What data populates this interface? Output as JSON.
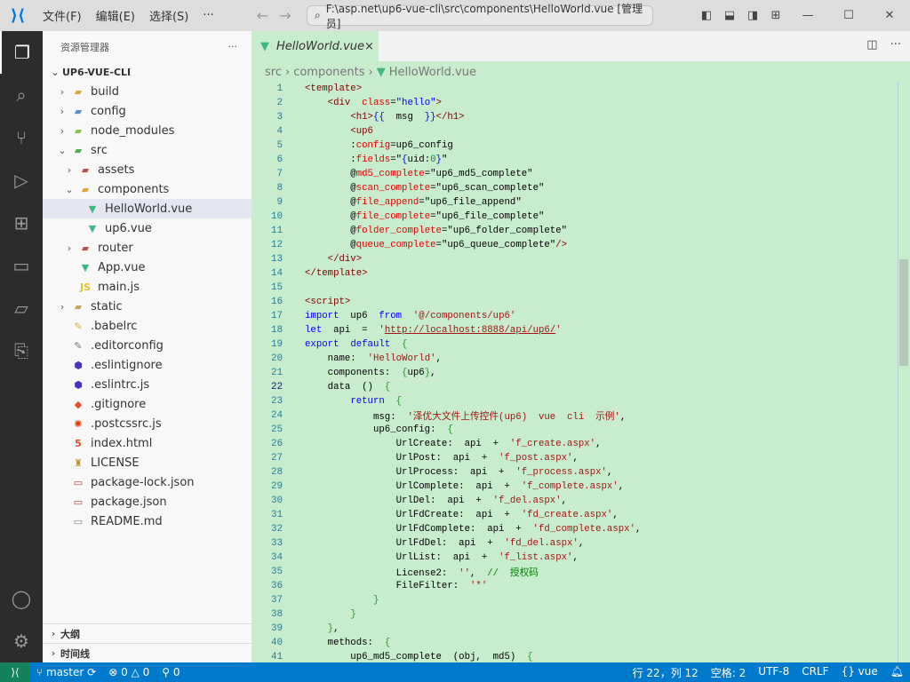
{
  "titlebar": {
    "menus": [
      "文件(F)",
      "编辑(E)",
      "选择(S)",
      "···"
    ],
    "search": "F:\\asp.net\\up6-vue-cli\\src\\components\\HelloWorld.vue [管理员]"
  },
  "sidebar": {
    "title": "资源管理器",
    "more": "···",
    "root": "UP6-VUE-CLI",
    "items": [
      {
        "label": "build",
        "depth": 0,
        "chev": "›",
        "icon": "folder-icon",
        "glyph": "▰",
        "color": "#d9a63b"
      },
      {
        "label": "config",
        "depth": 0,
        "chev": "›",
        "icon": "folder-config-icon",
        "glyph": "▰",
        "color": "#5b8fc7"
      },
      {
        "label": "node_modules",
        "depth": 0,
        "chev": "›",
        "icon": "folder-node-icon",
        "glyph": "▰",
        "color": "#8bc34a"
      },
      {
        "label": "src",
        "depth": 0,
        "chev": "⌄",
        "icon": "folder-src-icon",
        "glyph": "▰",
        "color": "#4caf50"
      },
      {
        "label": "assets",
        "depth": 1,
        "chev": "›",
        "icon": "folder-assets-icon",
        "glyph": "▰",
        "color": "#c0504d"
      },
      {
        "label": "components",
        "depth": 1,
        "chev": "⌄",
        "icon": "folder-components-icon",
        "glyph": "▰",
        "color": "#e8a33d"
      },
      {
        "label": "HelloWorld.vue",
        "depth": 2,
        "chev": "",
        "icon": "vue-icon",
        "glyph": "▼",
        "color": "#41b883",
        "selected": true
      },
      {
        "label": "up6.vue",
        "depth": 2,
        "chev": "",
        "icon": "vue-icon",
        "glyph": "▼",
        "color": "#41b883"
      },
      {
        "label": "router",
        "depth": 1,
        "chev": "›",
        "icon": "folder-router-icon",
        "glyph": "▰",
        "color": "#c0504d"
      },
      {
        "label": "App.vue",
        "depth": 1,
        "chev": "",
        "icon": "vue-icon",
        "glyph": "▼",
        "color": "#41b883"
      },
      {
        "label": "main.js",
        "depth": 1,
        "chev": "",
        "icon": "js-icon",
        "glyph": "JS",
        "color": "#e8c32c"
      },
      {
        "label": "static",
        "depth": 0,
        "chev": "›",
        "icon": "folder-icon",
        "glyph": "▰",
        "color": "#c9a45c"
      },
      {
        "label": ".babelrc",
        "depth": 0,
        "chev": "",
        "icon": "babel-icon",
        "glyph": "✎",
        "color": "#d6b13c"
      },
      {
        "label": ".editorconfig",
        "depth": 0,
        "chev": "",
        "icon": "editorconfig-icon",
        "glyph": "✎",
        "color": "#777"
      },
      {
        "label": ".eslintignore",
        "depth": 0,
        "chev": "",
        "icon": "eslint-icon",
        "glyph": "⬢",
        "color": "#4b32c3"
      },
      {
        "label": ".eslintrc.js",
        "depth": 0,
        "chev": "",
        "icon": "eslint-icon",
        "glyph": "⬢",
        "color": "#4b32c3"
      },
      {
        "label": ".gitignore",
        "depth": 0,
        "chev": "",
        "icon": "git-icon",
        "glyph": "◆",
        "color": "#e44d26"
      },
      {
        "label": ".postcssrc.js",
        "depth": 0,
        "chev": "",
        "icon": "postcss-icon",
        "glyph": "✺",
        "color": "#dd3a0a"
      },
      {
        "label": "index.html",
        "depth": 0,
        "chev": "",
        "icon": "html-icon",
        "glyph": "5",
        "color": "#e44d26"
      },
      {
        "label": "LICENSE",
        "depth": 0,
        "chev": "",
        "icon": "license-icon",
        "glyph": "♜",
        "color": "#c09030"
      },
      {
        "label": "package-lock.json",
        "depth": 0,
        "chev": "",
        "icon": "npm-icon",
        "glyph": "▭",
        "color": "#cb3837"
      },
      {
        "label": "package.json",
        "depth": 0,
        "chev": "",
        "icon": "npm-icon",
        "glyph": "▭",
        "color": "#cb3837"
      },
      {
        "label": "README.md",
        "depth": 0,
        "chev": "",
        "icon": "markdown-icon",
        "glyph": "▭",
        "color": "#888"
      }
    ],
    "panels": [
      "大纲",
      "时间线"
    ]
  },
  "editor": {
    "tab": "HelloWorld.vue",
    "tab_close": "×",
    "breadcrumbs": [
      "src",
      "components",
      "HelloWorld.vue"
    ],
    "current_line": 22,
    "lines": [
      [
        [
          "tag",
          "<template>"
        ]
      ],
      [
        [
          "pl",
          "    "
        ],
        [
          "tag",
          "<div "
        ],
        [
          "attr",
          " class"
        ],
        [
          "pl",
          "="
        ],
        [
          "val",
          "\"hello\""
        ],
        [
          "tag",
          ">"
        ]
      ],
      [
        [
          "pl",
          "        "
        ],
        [
          "tag",
          "<h1>"
        ],
        [
          "val",
          "{{"
        ],
        [
          "pl",
          "  msg  "
        ],
        [
          "val",
          "}}"
        ],
        [
          "tag",
          "</h1>"
        ]
      ],
      [
        [
          "pl",
          "        "
        ],
        [
          "tag",
          "<up6"
        ]
      ],
      [
        [
          "pl",
          "        :"
        ],
        [
          "attr",
          "config"
        ],
        [
          "pl",
          "=up6_config"
        ]
      ],
      [
        [
          "pl",
          "        :"
        ],
        [
          "attr",
          "fields"
        ],
        [
          "pl",
          "=\""
        ],
        [
          "val",
          "{"
        ],
        [
          "pl",
          "uid:"
        ],
        [
          "t",
          "0"
        ],
        [
          "val",
          "}"
        ],
        [
          "pl",
          "\""
        ]
      ],
      [
        [
          "pl",
          "        @"
        ],
        [
          "attr",
          "md5_complete"
        ],
        [
          "pl",
          "=\"up6_md5_complete\""
        ]
      ],
      [
        [
          "pl",
          "        @"
        ],
        [
          "attr",
          "scan_complete"
        ],
        [
          "pl",
          "=\"up6_scan_complete\""
        ]
      ],
      [
        [
          "pl",
          "        @"
        ],
        [
          "attr",
          "file_append"
        ],
        [
          "pl",
          "=\"up6_file_append\""
        ]
      ],
      [
        [
          "pl",
          "        @"
        ],
        [
          "attr",
          "file_complete"
        ],
        [
          "pl",
          "=\"up6_file_complete\""
        ]
      ],
      [
        [
          "pl",
          "        @"
        ],
        [
          "attr",
          "folder_complete"
        ],
        [
          "pl",
          "=\"up6_folder_complete\""
        ]
      ],
      [
        [
          "pl",
          "        @"
        ],
        [
          "attr",
          "queue_complete"
        ],
        [
          "pl",
          "=\"up6_queue_complete\""
        ],
        [
          "tag",
          "/>"
        ]
      ],
      [
        [
          "pl",
          "    "
        ],
        [
          "tag",
          "</div>"
        ]
      ],
      [
        [
          "tag",
          "</template>"
        ]
      ],
      [],
      [
        [
          "tag",
          "<script>"
        ]
      ],
      [
        [
          "kw",
          "import"
        ],
        [
          "pl",
          "  up6  "
        ],
        [
          "kw",
          "from"
        ],
        [
          "pl",
          "  "
        ],
        [
          "str",
          "'@/components/up6'"
        ]
      ],
      [
        [
          "kw",
          "let"
        ],
        [
          "pl",
          "  api  =  "
        ],
        [
          "str",
          "'"
        ],
        [
          "url",
          "http://localhost:8888/api/up6/"
        ],
        [
          "str",
          "'"
        ]
      ],
      [
        [
          "kw",
          "export"
        ],
        [
          "pl",
          "  "
        ],
        [
          "kw",
          "default"
        ],
        [
          "pl",
          "  "
        ],
        [
          "br",
          "{"
        ]
      ],
      [
        [
          "pl",
          "    name:  "
        ],
        [
          "str",
          "'HelloWorld'"
        ],
        [
          "pl",
          ","
        ]
      ],
      [
        [
          "pl",
          "    components:  "
        ],
        [
          "br",
          "{"
        ],
        [
          "pl",
          "up6"
        ],
        [
          "br",
          "}"
        ],
        [
          "pl",
          ","
        ]
      ],
      [
        [
          "pl",
          "    data  ()  "
        ],
        [
          "br",
          "{"
        ]
      ],
      [
        [
          "pl",
          "        "
        ],
        [
          "kw",
          "return"
        ],
        [
          "pl",
          "  "
        ],
        [
          "br",
          "{"
        ]
      ],
      [
        [
          "pl",
          "            msg:  "
        ],
        [
          "str",
          "'泽优大文件上传控件(up6)  vue  cli  示例'"
        ],
        [
          "pl",
          ","
        ]
      ],
      [
        [
          "pl",
          "            up6_config:  "
        ],
        [
          "br",
          "{"
        ]
      ],
      [
        [
          "pl",
          "                UrlCreate:  api  +  "
        ],
        [
          "str",
          "'f_create.aspx'"
        ],
        [
          "pl",
          ","
        ]
      ],
      [
        [
          "pl",
          "                UrlPost:  api  +  "
        ],
        [
          "str",
          "'f_post.aspx'"
        ],
        [
          "pl",
          ","
        ]
      ],
      [
        [
          "pl",
          "                UrlProcess:  api  +  "
        ],
        [
          "str",
          "'f_process.aspx'"
        ],
        [
          "pl",
          ","
        ]
      ],
      [
        [
          "pl",
          "                UrlComplete:  api  +  "
        ],
        [
          "str",
          "'f_complete.aspx'"
        ],
        [
          "pl",
          ","
        ]
      ],
      [
        [
          "pl",
          "                UrlDel:  api  +  "
        ],
        [
          "str",
          "'f_del.aspx'"
        ],
        [
          "pl",
          ","
        ]
      ],
      [
        [
          "pl",
          "                UrlFdCreate:  api  +  "
        ],
        [
          "str",
          "'fd_create.aspx'"
        ],
        [
          "pl",
          ","
        ]
      ],
      [
        [
          "pl",
          "                UrlFdComplete:  api  +  "
        ],
        [
          "str",
          "'fd_complete.aspx'"
        ],
        [
          "pl",
          ","
        ]
      ],
      [
        [
          "pl",
          "                UrlFdDel:  api  +  "
        ],
        [
          "str",
          "'fd_del.aspx'"
        ],
        [
          "pl",
          ","
        ]
      ],
      [
        [
          "pl",
          "                UrlList:  api  +  "
        ],
        [
          "str",
          "'f_list.aspx'"
        ],
        [
          "pl",
          ","
        ]
      ],
      [
        [
          "pl",
          "                License2:  "
        ],
        [
          "str",
          "''"
        ],
        [
          "pl",
          ",  "
        ],
        [
          "cm",
          "//  授权码"
        ]
      ],
      [
        [
          "pl",
          "                FileFilter:  "
        ],
        [
          "str",
          "'*'"
        ]
      ],
      [
        [
          "pl",
          "            "
        ],
        [
          "br",
          "}"
        ]
      ],
      [
        [
          "pl",
          "        "
        ],
        [
          "br",
          "}"
        ]
      ],
      [
        [
          "pl",
          "    "
        ],
        [
          "br",
          "}"
        ],
        [
          "pl",
          ","
        ]
      ],
      [
        [
          "pl",
          "    methods:  "
        ],
        [
          "br",
          "{"
        ]
      ],
      [
        [
          "pl",
          "        up6_md5_complete  (obj,  md5)  "
        ],
        [
          "br",
          "{"
        ]
      ]
    ]
  },
  "status": {
    "branch": "master",
    "errors": "0",
    "warnings": "0",
    "ports": "0",
    "position": "行 22，列 12",
    "spaces": "空格: 2",
    "encoding": "UTF-8",
    "eol": "CRLF",
    "language": "vue"
  },
  "colors": {
    "editor_bg": "#c7edcc",
    "status_bg": "#007acc",
    "accent": "#0078d4"
  }
}
